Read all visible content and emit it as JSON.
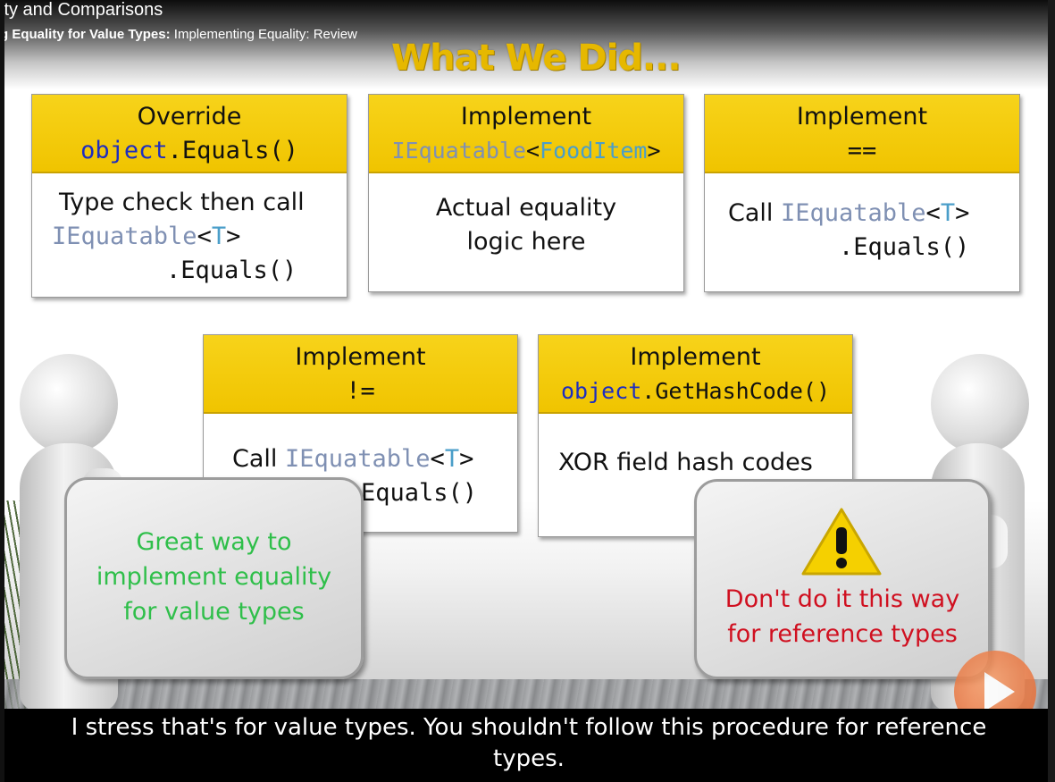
{
  "player": {
    "course_title": "ity and Comparisons",
    "breadcrumb_module": "g Equality for Value Types:",
    "breadcrumb_clip": " Implementing Equality: Review",
    "brand_watermark": "pluralsight",
    "caption_line1": "I stress that's for value types. You shouldn't follow this procedure for reference",
    "caption_line2": "types."
  },
  "slide": {
    "heading": "What We Did...",
    "cards": {
      "equals_override": {
        "head_line1": "Override",
        "head_kw": "object",
        "head_rest": ".Equals()",
        "body_line1": "Type check then call",
        "body_kw": "IEquatable",
        "body_lt": "<",
        "body_t": "T",
        "body_gt": ">",
        "body_line3": ".Equals()"
      },
      "iequatable": {
        "head_line1": "Implement",
        "head_kw": "IEquatable",
        "head_lt": "<",
        "head_type": "FoodItem",
        "head_gt": ">",
        "body_line1": "Actual equality",
        "body_line2": "logic here"
      },
      "eq_operator": {
        "head_line1": "Implement",
        "head_line2": "==",
        "body_prefix": "Call ",
        "body_kw": "IEquatable",
        "body_lt": "<",
        "body_t": "T",
        "body_gt": ">",
        "body_line2": ".Equals()"
      },
      "neq_operator": {
        "head_line1": "Implement",
        "head_line2": "!=",
        "body_prefix": "Call ",
        "body_kw": "IEquatable",
        "body_lt": "<",
        "body_t": "T",
        "body_gt": ">",
        "body_line2": "Equals()"
      },
      "gethashcode": {
        "head_line1": "Implement",
        "head_kw": "object",
        "head_rest": ".GetHashCode()",
        "body_line1": "XOR field hash codes"
      }
    },
    "placard_left": {
      "line1": "Great way to",
      "line2": "implement equality",
      "line3": "for value types",
      "color": "#2fbf4a"
    },
    "placard_right": {
      "warning_icon": "warning-icon",
      "line1": "Don't do it this way",
      "line2": "for reference types",
      "color": "#d01020"
    }
  },
  "colors": {
    "card_header": "#f0c400",
    "keyword_blue": "#1d2dc0",
    "type_teal": "#4a9ec9",
    "heading_gold": "#e6b800"
  }
}
